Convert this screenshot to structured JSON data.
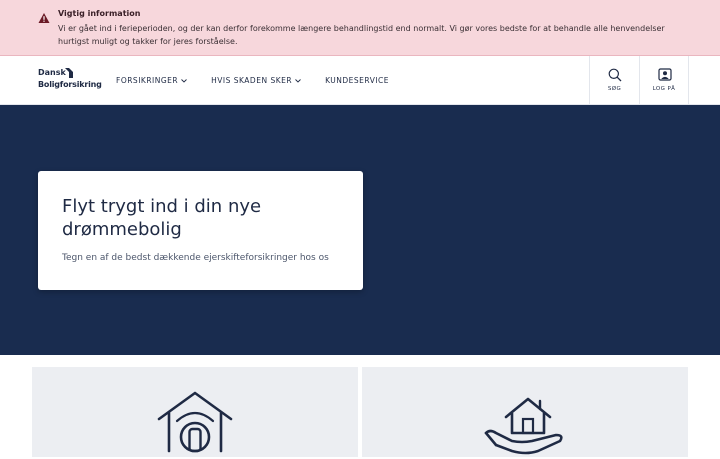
{
  "alert": {
    "icon": "warning-icon",
    "title": "Vigtig information",
    "body": "Vi er gået ind i ferieperioden, og der kan derfor forekomme længere behandlingstid end normalt. Vi gør vores bedste for at behandle alle henvendelser hurtigst muligt og takker for jeres forståelse."
  },
  "header": {
    "logo_line1": "Dansk",
    "logo_line2": "Boligforsikring",
    "nav": [
      {
        "label": "FORSIKRINGER",
        "has_dropdown": true
      },
      {
        "label": "HVIS SKADEN SKER",
        "has_dropdown": true
      },
      {
        "label": "KUNDESERVICE",
        "has_dropdown": false
      }
    ],
    "search_label": "SØG",
    "login_label": "LOG PÅ"
  },
  "hero": {
    "title": "Flyt trygt ind i din nye drømmebolig",
    "subtitle": "Tegn en af de bedst dækkende ejerskifteforsikringer hos os"
  },
  "cards": [
    {
      "icon": "house-door-icon"
    },
    {
      "icon": "house-in-hand-icon"
    }
  ],
  "colors": {
    "alert_bg": "#f7d7dc",
    "navy": "#192c4f",
    "text": "#1f2a44",
    "card_bg": "#eceef2"
  }
}
